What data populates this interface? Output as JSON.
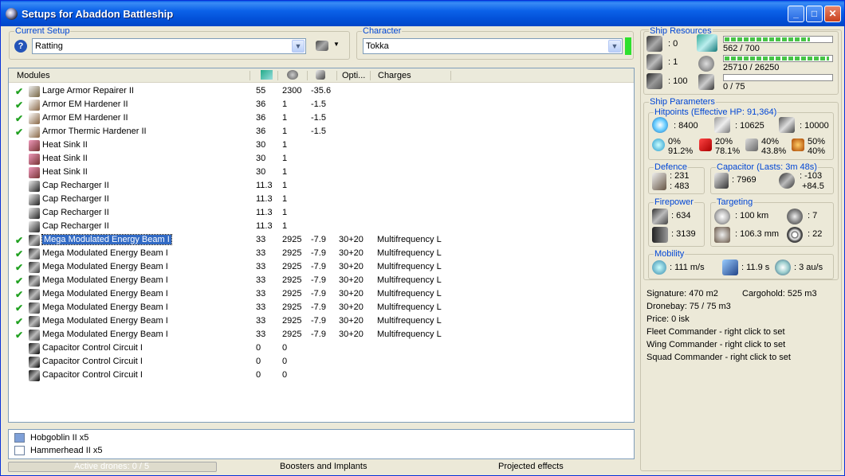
{
  "window": {
    "title": "Setups for Abaddon Battleship"
  },
  "setup": {
    "label": "Current Setup",
    "value": "Ratting"
  },
  "character": {
    "label": "Character",
    "value": "Tokka"
  },
  "modules": {
    "headers": {
      "modules": "Modules",
      "opti": "Opti...",
      "charges": "Charges"
    },
    "rows": [
      {
        "checked": true,
        "name": "Large Armor Repairer II",
        "c1": "55",
        "c2": "2300",
        "c3": "-35.6",
        "opti": "",
        "charges": "",
        "icon": "armor-repairer-icon"
      },
      {
        "checked": true,
        "name": "Armor EM Hardener II",
        "c1": "36",
        "c2": "1",
        "c3": "-1.5",
        "opti": "",
        "charges": "",
        "icon": "hardener-icon"
      },
      {
        "checked": true,
        "name": "Armor EM Hardener II",
        "c1": "36",
        "c2": "1",
        "c3": "-1.5",
        "opti": "",
        "charges": "",
        "icon": "hardener-icon"
      },
      {
        "checked": true,
        "name": "Armor Thermic Hardener II",
        "c1": "36",
        "c2": "1",
        "c3": "-1.5",
        "opti": "",
        "charges": "",
        "icon": "hardener-icon"
      },
      {
        "checked": false,
        "name": "Heat Sink II",
        "c1": "30",
        "c2": "1",
        "c3": "",
        "opti": "",
        "charges": "",
        "icon": "heat-sink-icon"
      },
      {
        "checked": false,
        "name": "Heat Sink II",
        "c1": "30",
        "c2": "1",
        "c3": "",
        "opti": "",
        "charges": "",
        "icon": "heat-sink-icon"
      },
      {
        "checked": false,
        "name": "Heat Sink II",
        "c1": "30",
        "c2": "1",
        "c3": "",
        "opti": "",
        "charges": "",
        "icon": "heat-sink-icon"
      },
      {
        "checked": false,
        "name": "Cap Recharger II",
        "c1": "11.3",
        "c2": "1",
        "c3": "",
        "opti": "",
        "charges": "",
        "icon": "cap-recharger-icon"
      },
      {
        "checked": false,
        "name": "Cap Recharger II",
        "c1": "11.3",
        "c2": "1",
        "c3": "",
        "opti": "",
        "charges": "",
        "icon": "cap-recharger-icon"
      },
      {
        "checked": false,
        "name": "Cap Recharger II",
        "c1": "11.3",
        "c2": "1",
        "c3": "",
        "opti": "",
        "charges": "",
        "icon": "cap-recharger-icon"
      },
      {
        "checked": false,
        "name": "Cap Recharger II",
        "c1": "11.3",
        "c2": "1",
        "c3": "",
        "opti": "",
        "charges": "",
        "icon": "cap-recharger-icon"
      },
      {
        "checked": true,
        "name": "Mega Modulated Energy Beam I",
        "c1": "33",
        "c2": "2925",
        "c3": "-7.9",
        "opti": "30+20",
        "charges": "Multifrequency L",
        "icon": "energy-beam-icon",
        "selected": true
      },
      {
        "checked": true,
        "name": "Mega Modulated Energy Beam I",
        "c1": "33",
        "c2": "2925",
        "c3": "-7.9",
        "opti": "30+20",
        "charges": "Multifrequency L",
        "icon": "energy-beam-icon"
      },
      {
        "checked": true,
        "name": "Mega Modulated Energy Beam I",
        "c1": "33",
        "c2": "2925",
        "c3": "-7.9",
        "opti": "30+20",
        "charges": "Multifrequency L",
        "icon": "energy-beam-icon"
      },
      {
        "checked": true,
        "name": "Mega Modulated Energy Beam I",
        "c1": "33",
        "c2": "2925",
        "c3": "-7.9",
        "opti": "30+20",
        "charges": "Multifrequency L",
        "icon": "energy-beam-icon"
      },
      {
        "checked": true,
        "name": "Mega Modulated Energy Beam I",
        "c1": "33",
        "c2": "2925",
        "c3": "-7.9",
        "opti": "30+20",
        "charges": "Multifrequency L",
        "icon": "energy-beam-icon"
      },
      {
        "checked": true,
        "name": "Mega Modulated Energy Beam I",
        "c1": "33",
        "c2": "2925",
        "c3": "-7.9",
        "opti": "30+20",
        "charges": "Multifrequency L",
        "icon": "energy-beam-icon"
      },
      {
        "checked": true,
        "name": "Mega Modulated Energy Beam I",
        "c1": "33",
        "c2": "2925",
        "c3": "-7.9",
        "opti": "30+20",
        "charges": "Multifrequency L",
        "icon": "energy-beam-icon"
      },
      {
        "checked": true,
        "name": "Mega Modulated Energy Beam I",
        "c1": "33",
        "c2": "2925",
        "c3": "-7.9",
        "opti": "30+20",
        "charges": "Multifrequency L",
        "icon": "energy-beam-icon"
      },
      {
        "checked": false,
        "name": "Capacitor Control Circuit I",
        "c1": "0",
        "c2": "0",
        "c3": "",
        "opti": "",
        "charges": "",
        "icon": "rig-icon"
      },
      {
        "checked": false,
        "name": "Capacitor Control Circuit I",
        "c1": "0",
        "c2": "0",
        "c3": "",
        "opti": "",
        "charges": "",
        "icon": "rig-icon"
      },
      {
        "checked": false,
        "name": "Capacitor Control Circuit I",
        "c1": "0",
        "c2": "0",
        "c3": "",
        "opti": "",
        "charges": "",
        "icon": "rig-icon"
      }
    ]
  },
  "drones": [
    {
      "name": "Hobgoblin II x5",
      "active": true
    },
    {
      "name": "Hammerhead II x5",
      "active": false
    }
  ],
  "bottom_tabs": {
    "active_drones": "Active drones: 0 / 5",
    "boosters": "Boosters and Implants",
    "projected": "Projected effects"
  },
  "resources": {
    "label": "Ship Resources",
    "hardpoints": [
      ": 0",
      ": 1",
      ": 100"
    ],
    "cpu": {
      "text": "562 / 700",
      "fraction": 0.8
    },
    "powergrid": {
      "text": "25710 / 26250",
      "fraction": 0.98
    },
    "calibration": {
      "text": "0 / 75",
      "fraction": 0.0
    }
  },
  "params": {
    "label": "Ship Parameters",
    "hitpoints_label": "Hitpoints (Effective HP: 91,364)",
    "shield_hp": ": 8400",
    "armor_hp": ": 10625",
    "structure_hp": ": 10000",
    "resists": {
      "em_shield": "0%",
      "em_armor": "91.2%",
      "thermal_shield": "20%",
      "thermal_armor": "78.1%",
      "kinetic_shield": "40%",
      "kinetic_armor": "43.8%",
      "explosive_shield": "50%",
      "explosive_armor": "40%"
    },
    "defence_label": "Defence",
    "defence_a": ": 231",
    "defence_b": ": 483",
    "capacitor_label": "Capacitor (Lasts: 3m 48s)",
    "capacitor_amount": ": 7969",
    "capacitor_a": ": -103",
    "capacitor_b": "+84.5",
    "firepower_label": "Firepower",
    "firepower_a": ": 634",
    "firepower_b": ": 3139",
    "targeting_label": "Targeting",
    "target_range": ": 100 km",
    "max_targets": ": 7",
    "scan_res": ": 106.3 mm",
    "sensor_str": ": 22",
    "mobility_label": "Mobility",
    "speed": ": 111 m/s",
    "align": ": 11.9 s",
    "warp": ": 3 au/s"
  },
  "info": {
    "signature": "Signature: 470 m2",
    "cargohold": "Cargohold: 525 m3",
    "dronebay": "Dronebay: 75 / 75 m3",
    "price": "Price: 0 isk",
    "fleet": "Fleet Commander - right click to set",
    "wing": "Wing Commander - right click to set",
    "squad": "Squad Commander - right click to set"
  }
}
